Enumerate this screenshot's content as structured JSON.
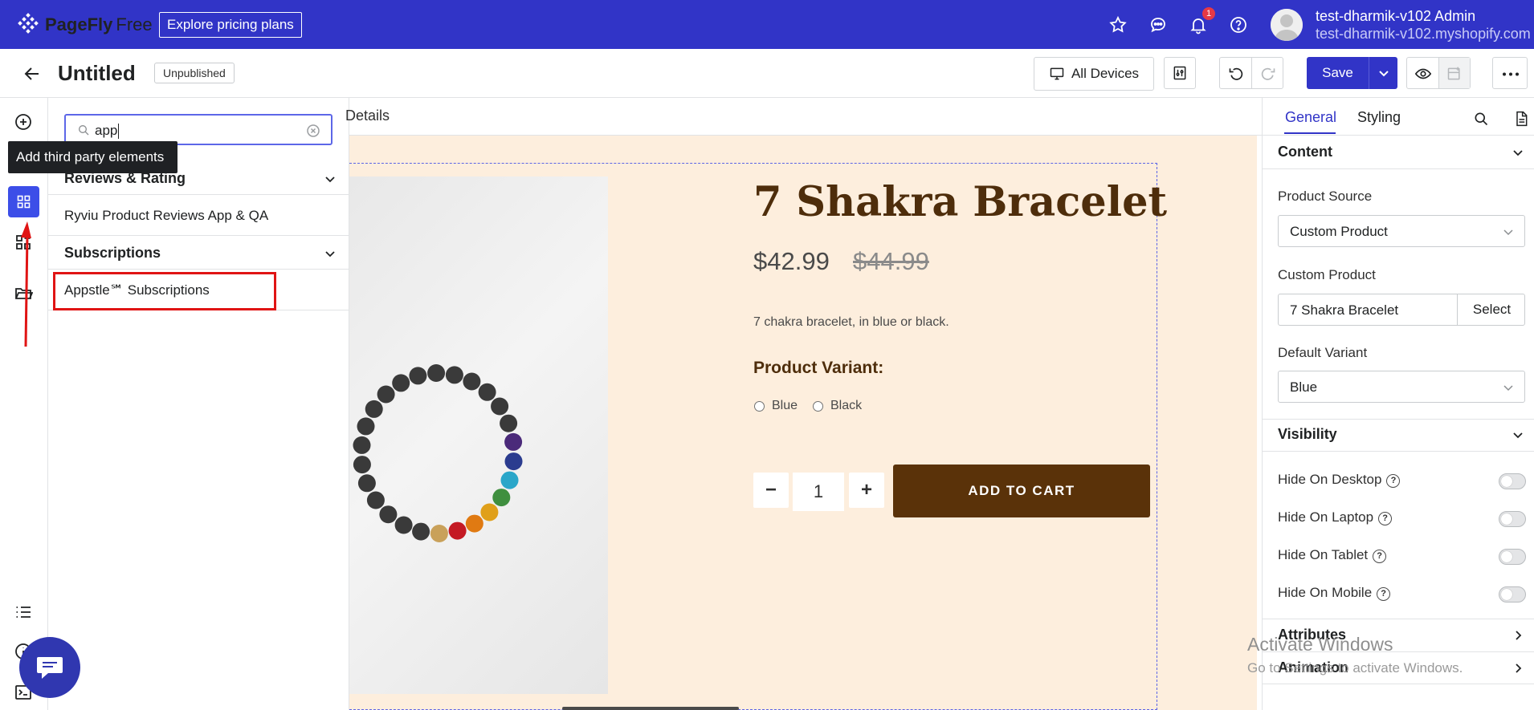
{
  "topbar": {
    "brand": "PageFly",
    "plan": "Free",
    "pricing_link": "Explore pricing plans",
    "notification_count": "1",
    "user_name": "test-dharmik-v102 Admin",
    "user_store": "test-dharmik-v102.myshopify.com",
    "icons": [
      "star-icon",
      "chat-bubble-icon",
      "bell-icon",
      "help-icon"
    ]
  },
  "editor": {
    "page_title": "Untitled",
    "status": "Unpublished",
    "devices_label": "All Devices",
    "save_label": "Save"
  },
  "sidebar": {
    "tooltip": "Add third party elements",
    "search_value": "app",
    "sections": [
      {
        "title": "Reviews & Rating",
        "items": [
          "Ryviu Product Reviews App & QA"
        ]
      },
      {
        "title": "Subscriptions",
        "items": [
          "Appstle℠ Subscriptions"
        ]
      }
    ]
  },
  "canvas": {
    "breadcrumb": "Details",
    "product": {
      "title": "7 Shakra Bracelet",
      "price": "$42.99",
      "compare_price": "$44.99",
      "description": "7 chakra bracelet, in blue or black.",
      "variant_label": "Product Variant:",
      "variants": [
        "Blue",
        "Black"
      ],
      "quantity": "1",
      "qty_minus": "−",
      "qty_plus": "+",
      "add_to_cart": "ADD TO CART"
    }
  },
  "inspector": {
    "tabs": [
      "General",
      "Styling"
    ],
    "content_heading": "Content",
    "product_source_label": "Product Source",
    "product_source_value": "Custom Product",
    "custom_product_label": "Custom Product",
    "custom_product_value": "7 Shakra Bracelet",
    "select_label": "Select",
    "default_variant_label": "Default Variant",
    "default_variant_value": "Blue",
    "visibility_heading": "Visibility",
    "visibility": [
      "Hide On Desktop",
      "Hide On Laptop",
      "Hide On Tablet",
      "Hide On Mobile"
    ],
    "attributes_heading": "Attributes",
    "animation_heading": "Animation"
  },
  "watermark": {
    "line1": "Activate Windows",
    "line2": "Go to Settings to activate Windows."
  },
  "colors": {
    "brand": "#3134c7",
    "cart_button": "#5a3209",
    "product_title": "#4e2d0b",
    "canvas_bg": "#fdeedd",
    "annotation_red": "#e01414"
  }
}
